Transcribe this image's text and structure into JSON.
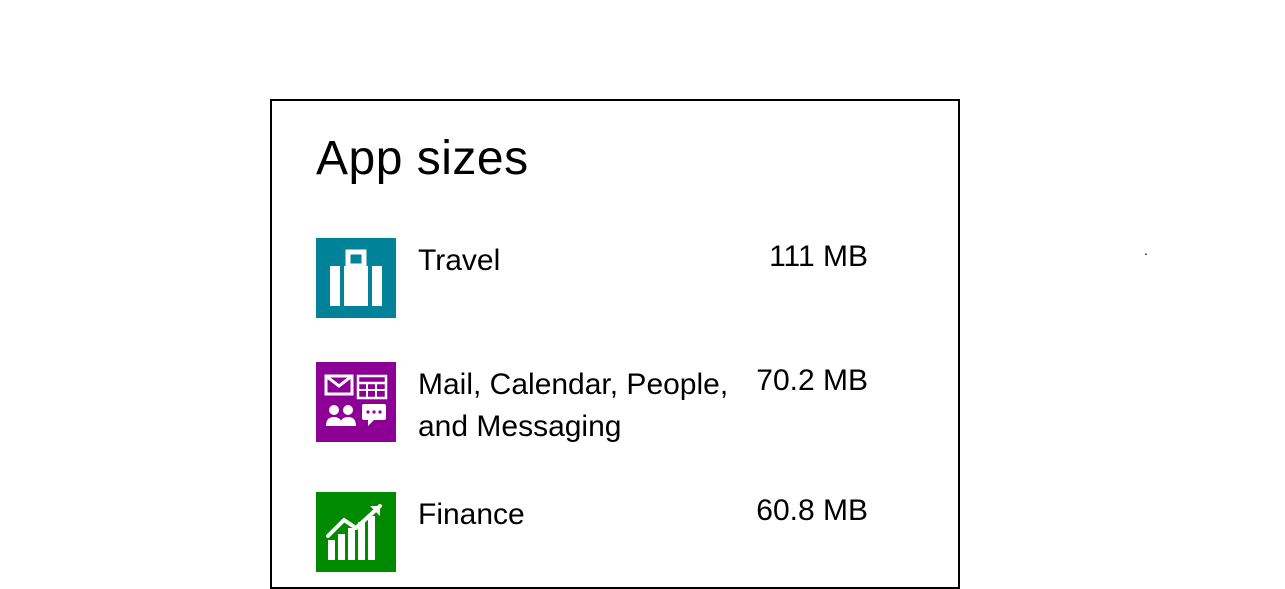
{
  "title": "App sizes",
  "apps": [
    {
      "name": "Travel",
      "size": "111 MB",
      "icon": "suitcase-icon",
      "color": "#008299"
    },
    {
      "name": "Mail, Calendar, People, and Messaging",
      "size": "70.2 MB",
      "icon": "mail-calendar-people-messaging-icon",
      "color": "#8C0095"
    },
    {
      "name": "Finance",
      "size": "60.8 MB",
      "icon": "chart-up-icon",
      "color": "#008A00"
    }
  ]
}
